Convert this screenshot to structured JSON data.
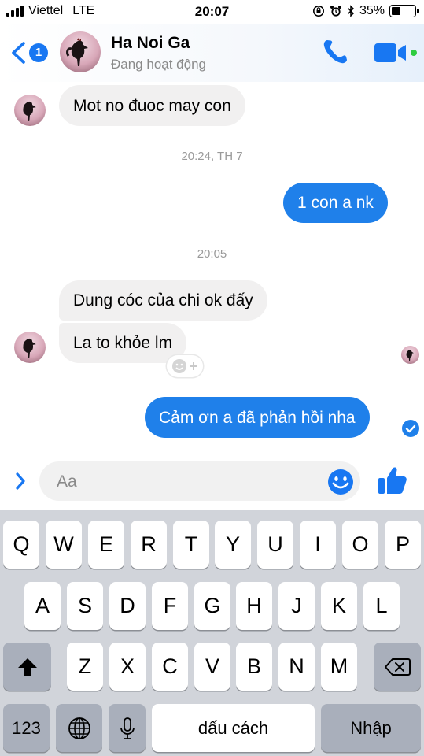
{
  "status_bar": {
    "carrier": "Viettel",
    "network": "LTE",
    "time": "20:07",
    "battery_percent": "35%",
    "battery_level": 0.35,
    "icons": [
      "orientation-lock-icon",
      "alarm-icon",
      "bluetooth-icon"
    ]
  },
  "header": {
    "back_badge": "1",
    "contact_name": "Ha Noi Ga",
    "contact_status": "Đang hoạt động",
    "accent": "#1877f2",
    "active_dot_color": "#2ecc40"
  },
  "messages": [
    {
      "direction": "in",
      "text": "Mot no đuoc may con"
    },
    {
      "type": "timestamp",
      "text": "20:24, TH 7"
    },
    {
      "direction": "out",
      "text": "1 con a nk"
    },
    {
      "type": "timestamp",
      "text": "20:05"
    },
    {
      "direction": "in",
      "text": "Dung cóc của chi ok đấy"
    },
    {
      "direction": "in",
      "text": "La to khỏe lm"
    },
    {
      "direction": "out",
      "text": "Cảm ơn a đã phản hồi nha"
    }
  ],
  "bubble_colors": {
    "incoming": "#f1f0f0",
    "outgoing": "#1f80ea"
  },
  "composer": {
    "placeholder": "Aa"
  },
  "keyboard": {
    "row1": [
      "Q",
      "W",
      "E",
      "R",
      "T",
      "Y",
      "U",
      "I",
      "O",
      "P"
    ],
    "row2": [
      "A",
      "S",
      "D",
      "F",
      "G",
      "H",
      "J",
      "K",
      "L"
    ],
    "row3": [
      "Z",
      "X",
      "C",
      "V",
      "B",
      "N",
      "M"
    ],
    "numbers_key": "123",
    "space_key": "dấu cách",
    "return_key": "Nhập"
  }
}
